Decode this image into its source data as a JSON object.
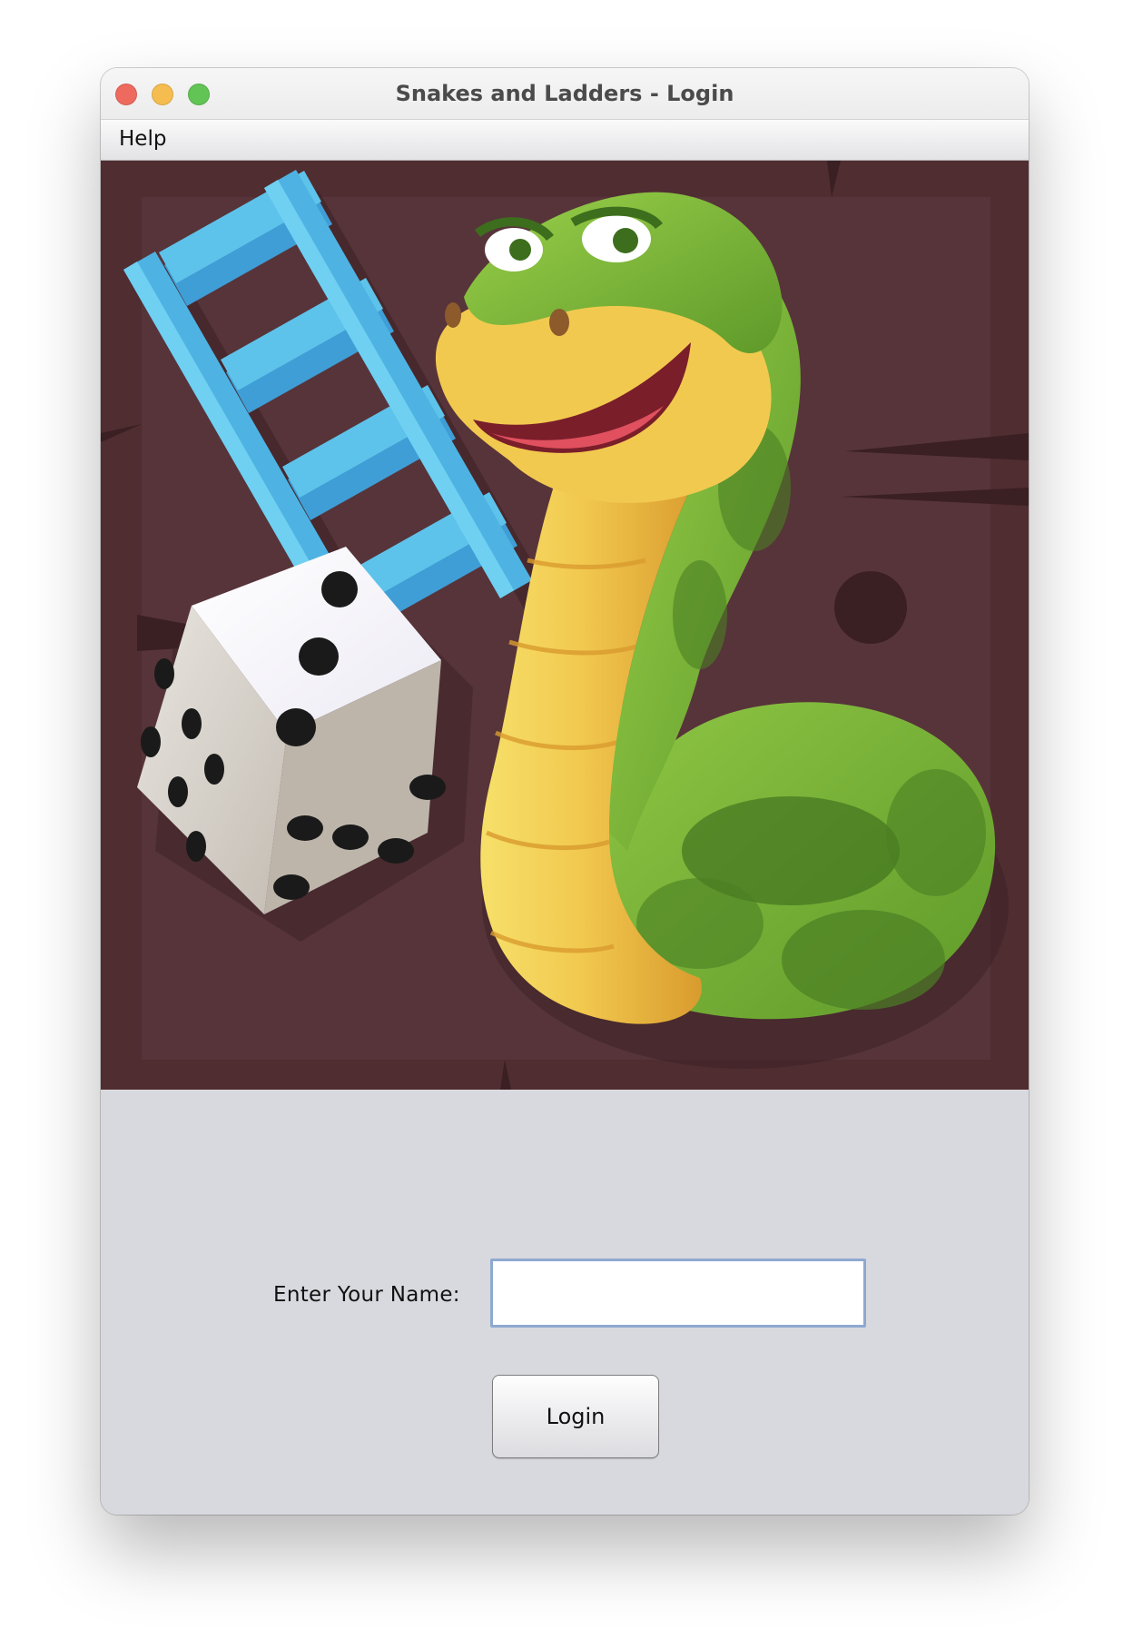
{
  "window": {
    "title": "Snakes and Ladders - Login"
  },
  "menubar": {
    "items": [
      {
        "label": "Help"
      }
    ]
  },
  "form": {
    "name_label": "Enter Your Name:",
    "name_value": "",
    "login_label": "Login"
  },
  "colors": {
    "artwork_background": "#502d31",
    "form_background": "#d8d9de",
    "input_focus_border": "#8ea9d1"
  }
}
